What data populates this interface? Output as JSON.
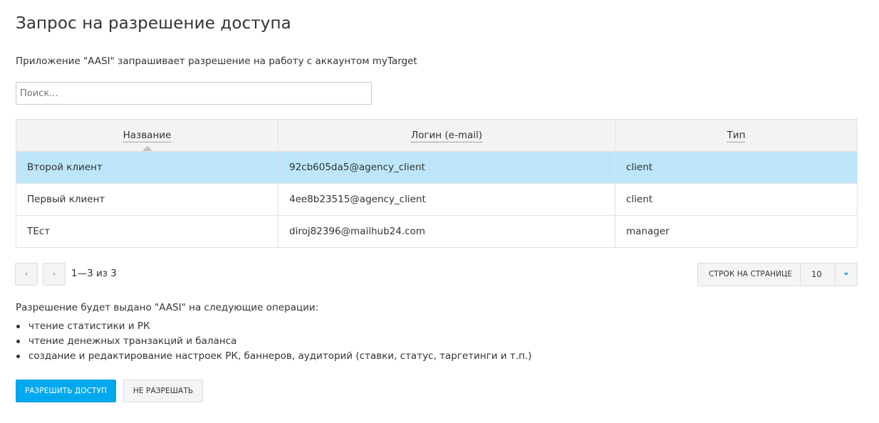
{
  "page": {
    "title": "Запрос на разрешение доступа",
    "subtitle": "Приложение \"AASI\" запрашивает разрешение на работу с аккаунтом myTarget"
  },
  "search": {
    "placeholder": "Поиск...",
    "value": ""
  },
  "table": {
    "columns": [
      {
        "label": "Название",
        "sorted": "asc"
      },
      {
        "label": "Логин (e-mail)"
      },
      {
        "label": "Тип"
      }
    ],
    "rows": [
      {
        "name": "Второй клиент",
        "login": "92cb605da5@agency_client",
        "type": "client",
        "selected": true
      },
      {
        "name": "Первый клиент",
        "login": "4ee8b23515@agency_client",
        "type": "client",
        "selected": false
      },
      {
        "name": "ТЕст",
        "login": "diroj82396@mailhub24.com",
        "type": "manager",
        "selected": false
      }
    ],
    "selected_row_color": "#bde6fa"
  },
  "pagination": {
    "info": "1—3 из 3",
    "prev_icon": "triangle-left-icon",
    "next_icon": "triangle-right-icon",
    "rows_per_page_label": "СТРОК НА СТРАНИЦЕ",
    "rows_per_page_value": "10",
    "dropdown_icon": "triangle-down-icon"
  },
  "operations": {
    "title": "Разрешение будет выдано \"AASI\" на следующие операции:",
    "items": [
      "чтение статистики и РК",
      "чтение денежных транзакций и баланса",
      "создание и редактирование настроек РК, баннеров, аудиторий (ставки, статус, таргетинги и т.п.)"
    ]
  },
  "actions": {
    "allow_label": "РАЗРЕШИТЬ ДОСТУП",
    "deny_label": "НЕ РАЗРЕШАТЬ",
    "accent_color": "#00a8ef"
  }
}
